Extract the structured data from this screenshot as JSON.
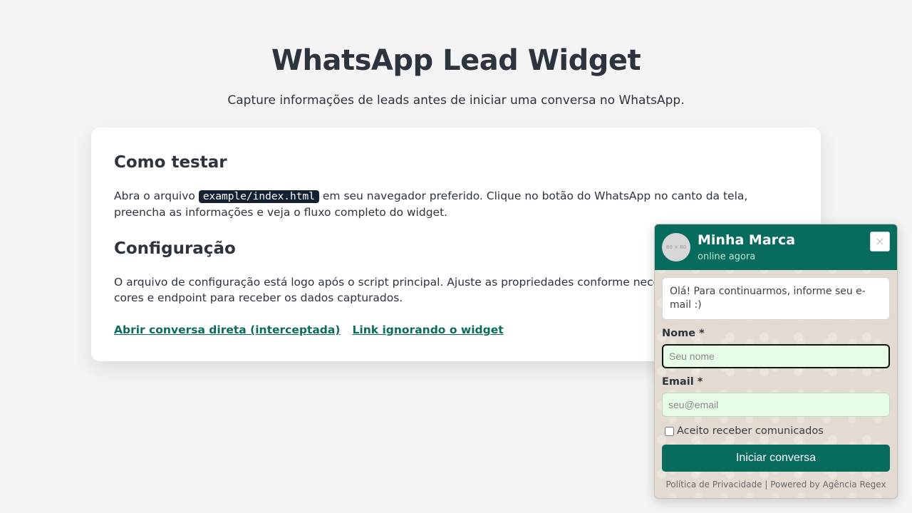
{
  "page": {
    "title": "WhatsApp Lead Widget",
    "subtitle": "Capture informações de leads antes de iniciar uma conversa no WhatsApp."
  },
  "card": {
    "section1": {
      "title": "Como testar",
      "text_before": "Abra o arquivo ",
      "code": "example/index.html",
      "text_after": " em seu navegador preferido. Clique no botão do WhatsApp no canto da tela, preencha as informações e veja o fluxo completo do widget."
    },
    "section2": {
      "title": "Configuração",
      "text": "O arquivo de configuração está logo após o script principal. Ajuste as propriedades conforme necess do WhatsApp, rótulos, cores e endpoint para receber os dados capturados."
    },
    "links": {
      "direct": "Abrir conversa direta (interceptada)",
      "ignore": "Link ignorando o widget"
    }
  },
  "widget": {
    "avatar_text": "80 × 80",
    "brand": "Minha Marca",
    "status": "online agora",
    "close_label": "×",
    "message": "Olá! Para continuarmos, informe seu e-mail :)",
    "name_label": "Nome *",
    "name_placeholder": "Seu nome",
    "email_label": "Email *",
    "email_placeholder": "seu@email",
    "consent_label": "Aceito receber comunicados",
    "consent_checked": false,
    "submit_label": "Iniciar conversa",
    "footer": "Política de Privacidade | Powered by Agência Regex"
  },
  "colors": {
    "accent": "#076b5d",
    "input_bg": "#e7fce6",
    "page_bg": "#f4f4f4"
  }
}
